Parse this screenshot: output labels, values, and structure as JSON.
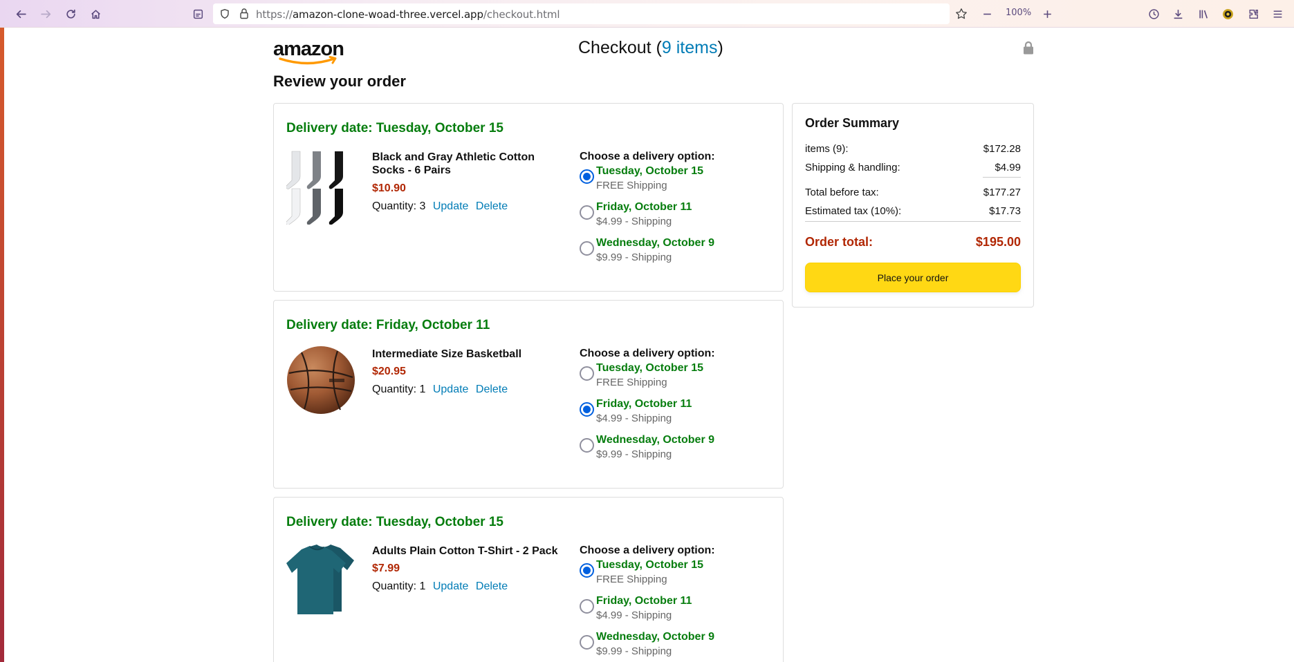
{
  "browser": {
    "url_prefix": "https://",
    "url_host": "amazon-clone-woad-three.vercel.app",
    "url_path": "/checkout.html",
    "zoom": "100%"
  },
  "header": {
    "logo_text": "amazon",
    "title_prefix": "Checkout (",
    "items_link": "9 items",
    "title_suffix": ")"
  },
  "review_title": "Review your order",
  "options_title": "Choose a delivery option:",
  "qty_label": "Quantity:",
  "update_label": "Update",
  "delete_label": "Delete",
  "delivery_options": [
    {
      "date": "Tuesday, October 15",
      "shipping": "FREE Shipping"
    },
    {
      "date": "Friday, October 11",
      "shipping": "$4.99 - Shipping"
    },
    {
      "date": "Wednesday, October 9",
      "shipping": "$9.99 - Shipping"
    }
  ],
  "cart": [
    {
      "delivery_date": "Delivery date: Tuesday, October 15",
      "name": "Black and Gray Athletic Cotton Socks - 6 Pairs",
      "price": "$10.90",
      "quantity": "3",
      "selected_option": 0,
      "image": "socks-image"
    },
    {
      "delivery_date": "Delivery date: Friday, October 11",
      "name": "Intermediate Size Basketball",
      "price": "$20.95",
      "quantity": "1",
      "selected_option": 1,
      "image": "basketball-image"
    },
    {
      "delivery_date": "Delivery date: Tuesday, October 15",
      "name": "Adults Plain Cotton T-Shirt - 2 Pack",
      "price": "$7.99",
      "quantity": "1",
      "selected_option": 0,
      "image": "tshirt-image"
    }
  ],
  "summary": {
    "title": "Order Summary",
    "items_label": "items (9):",
    "items_value": "$172.28",
    "shipping_label": "Shipping & handling:",
    "shipping_value": "$4.99",
    "before_tax_label": "Total before tax:",
    "before_tax_value": "$177.27",
    "tax_label": "Estimated tax (10%):",
    "tax_value": "$17.73",
    "total_label": "Order total:",
    "total_value": "$195.00",
    "button_label": "Place your order"
  },
  "colors": {
    "green": "#067d0e",
    "price_red": "#b12704",
    "link_blue": "#017cb6",
    "button_yellow": "#ffd814"
  }
}
